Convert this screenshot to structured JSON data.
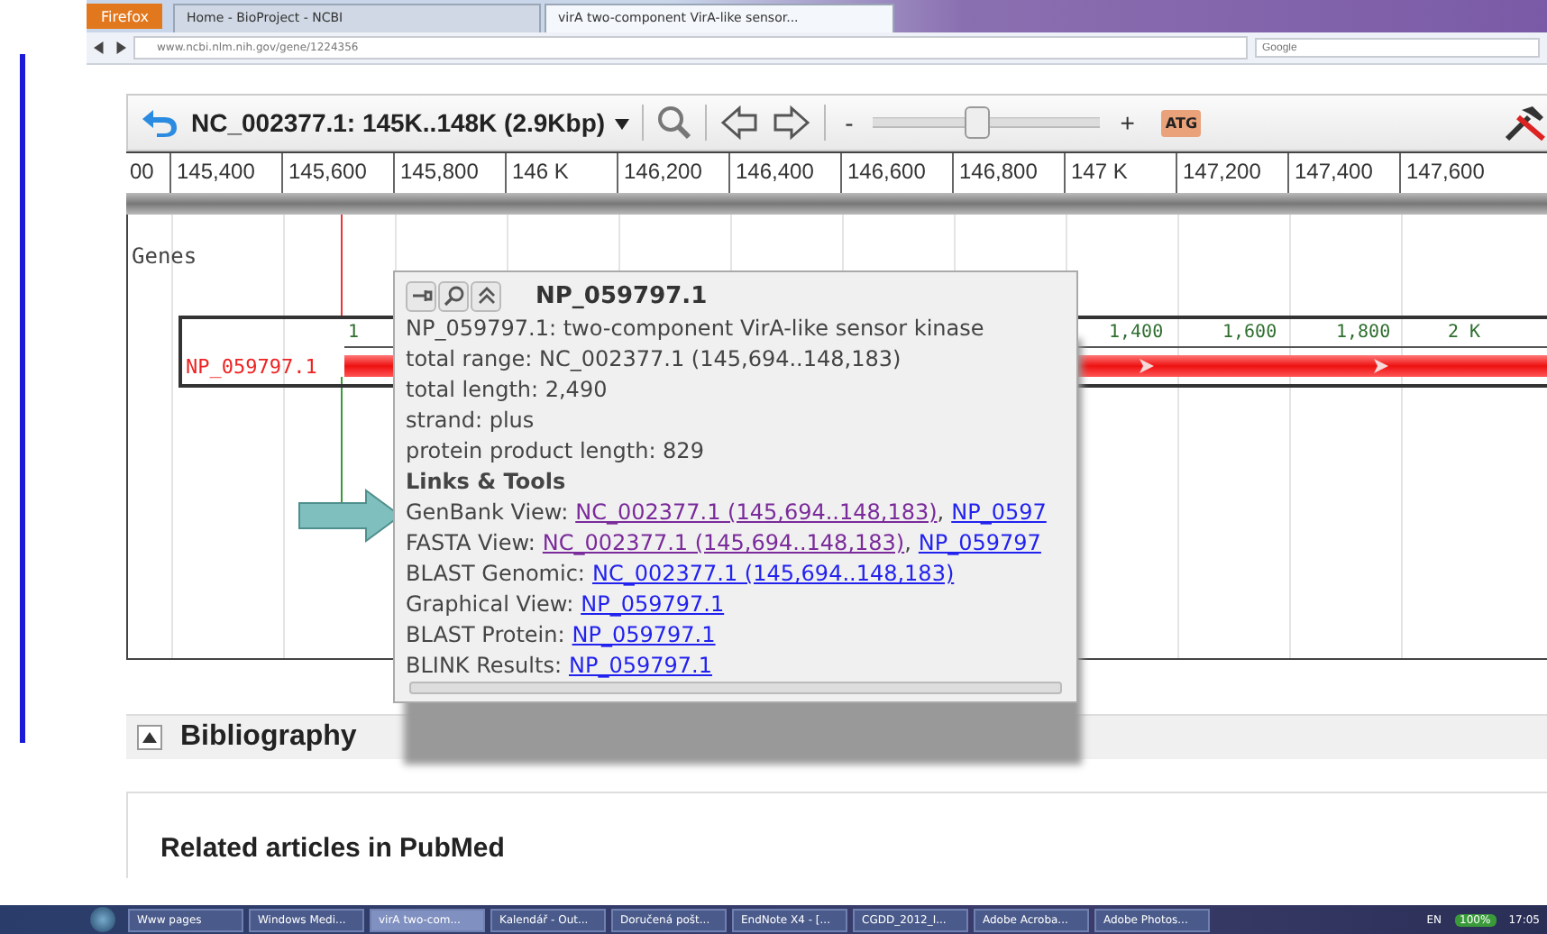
{
  "browser": {
    "menu_button": "Firefox",
    "tabs": [
      {
        "label": "Home - BioProject - NCBI",
        "selected": false
      },
      {
        "label": "virA two-component VirA-like sensor...",
        "selected": true
      }
    ],
    "address": "www.ncbi.nlm.nih.gov/gene/1224356",
    "search": {
      "placeholder": "Google"
    }
  },
  "toolbar": {
    "title": "NC_002377.1: 145K..148K (2.9Kbp)",
    "minus": "-",
    "plus": "+",
    "zoom": {
      "level": 0.45
    },
    "atg": "ATG"
  },
  "ruler": [
    "00",
    "145,400",
    "145,600",
    "145,800",
    "146 K",
    "146,200",
    "146,400",
    "146,600",
    "146,800",
    "147 K",
    "147,200",
    "147,400",
    "147,600"
  ],
  "track": {
    "label": "Genes",
    "gene": "NP_059797.1",
    "ticks": [
      "1",
      "1,400",
      "1,600",
      "1,800",
      "2 K"
    ]
  },
  "popup": {
    "title": "NP_059797.1",
    "lines": [
      "NP_059797.1: two-component VirA-like sensor kinase",
      "total range: NC_002377.1 (145,694..148,183)",
      "total length: 2,490",
      "strand: plus",
      "protein product length: 829"
    ],
    "section": "Links & Tools",
    "links": [
      {
        "label": "GenBank View:",
        "links": [
          {
            "text": "NC_002377.1 (145,694..148,183)",
            "visited": true,
            "suffix": ","
          },
          {
            "text": "NP_0597",
            "visited": false
          }
        ]
      },
      {
        "label": "FASTA View:",
        "links": [
          {
            "text": "NC_002377.1 (145,694..148,183)",
            "visited": true,
            "suffix": ","
          },
          {
            "text": "NP_059797",
            "visited": false
          }
        ]
      },
      {
        "label": "BLAST Genomic:",
        "links": [
          {
            "text": "NC_002377.1 (145,694..148,183)",
            "visited": false
          }
        ]
      },
      {
        "label": "Graphical View:",
        "links": [
          {
            "text": "NP_059797.1",
            "visited": false
          }
        ]
      },
      {
        "label": "BLAST Protein:",
        "links": [
          {
            "text": "NP_059797.1",
            "visited": false
          }
        ]
      },
      {
        "label": "BLINK Results:",
        "links": [
          {
            "text": "NP_059797.1",
            "visited": false
          }
        ]
      }
    ]
  },
  "sections": [
    {
      "title": "Bibliography"
    },
    {
      "title": "Related articles in PubMed"
    }
  ],
  "taskbar": {
    "items": [
      {
        "label": "Www pages",
        "selected": false
      },
      {
        "label": "Windows Medi...",
        "selected": false
      },
      {
        "label": "virA two-com...",
        "selected": true
      },
      {
        "label": "Kalendář - Out...",
        "selected": false
      },
      {
        "label": "Doručená pošt...",
        "selected": false
      },
      {
        "label": "EndNote X4 - [...",
        "selected": false
      },
      {
        "label": "CGDD_2012_I...",
        "selected": false
      },
      {
        "label": "Adobe Acroba...",
        "selected": false
      },
      {
        "label": "Adobe Photos...",
        "selected": false
      }
    ],
    "language": "EN",
    "battery": "100%",
    "clock": "17:05"
  }
}
